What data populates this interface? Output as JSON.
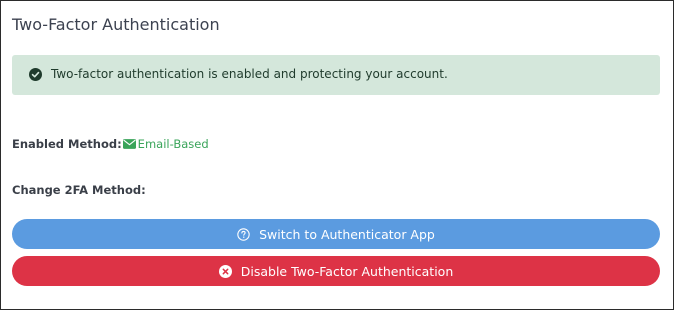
{
  "header": {
    "title": "Two-Factor Authentication"
  },
  "alert": {
    "message": "Two-factor authentication is enabled and protecting your account.",
    "icon": "check-circle-icon",
    "background_color": "#d4e7db"
  },
  "method": {
    "label": "Enabled Method:",
    "value": "Email-Based",
    "icon": "envelope-icon",
    "value_color": "#3aa45a"
  },
  "change": {
    "label": "Change 2FA Method:"
  },
  "buttons": {
    "switch": {
      "label": "Switch to Authenticator App",
      "icon": "question-circle-icon",
      "color": "#5b9be0"
    },
    "disable": {
      "label": "Disable Two-Factor Authentication",
      "icon": "x-circle-icon",
      "color": "#dd3346"
    }
  }
}
